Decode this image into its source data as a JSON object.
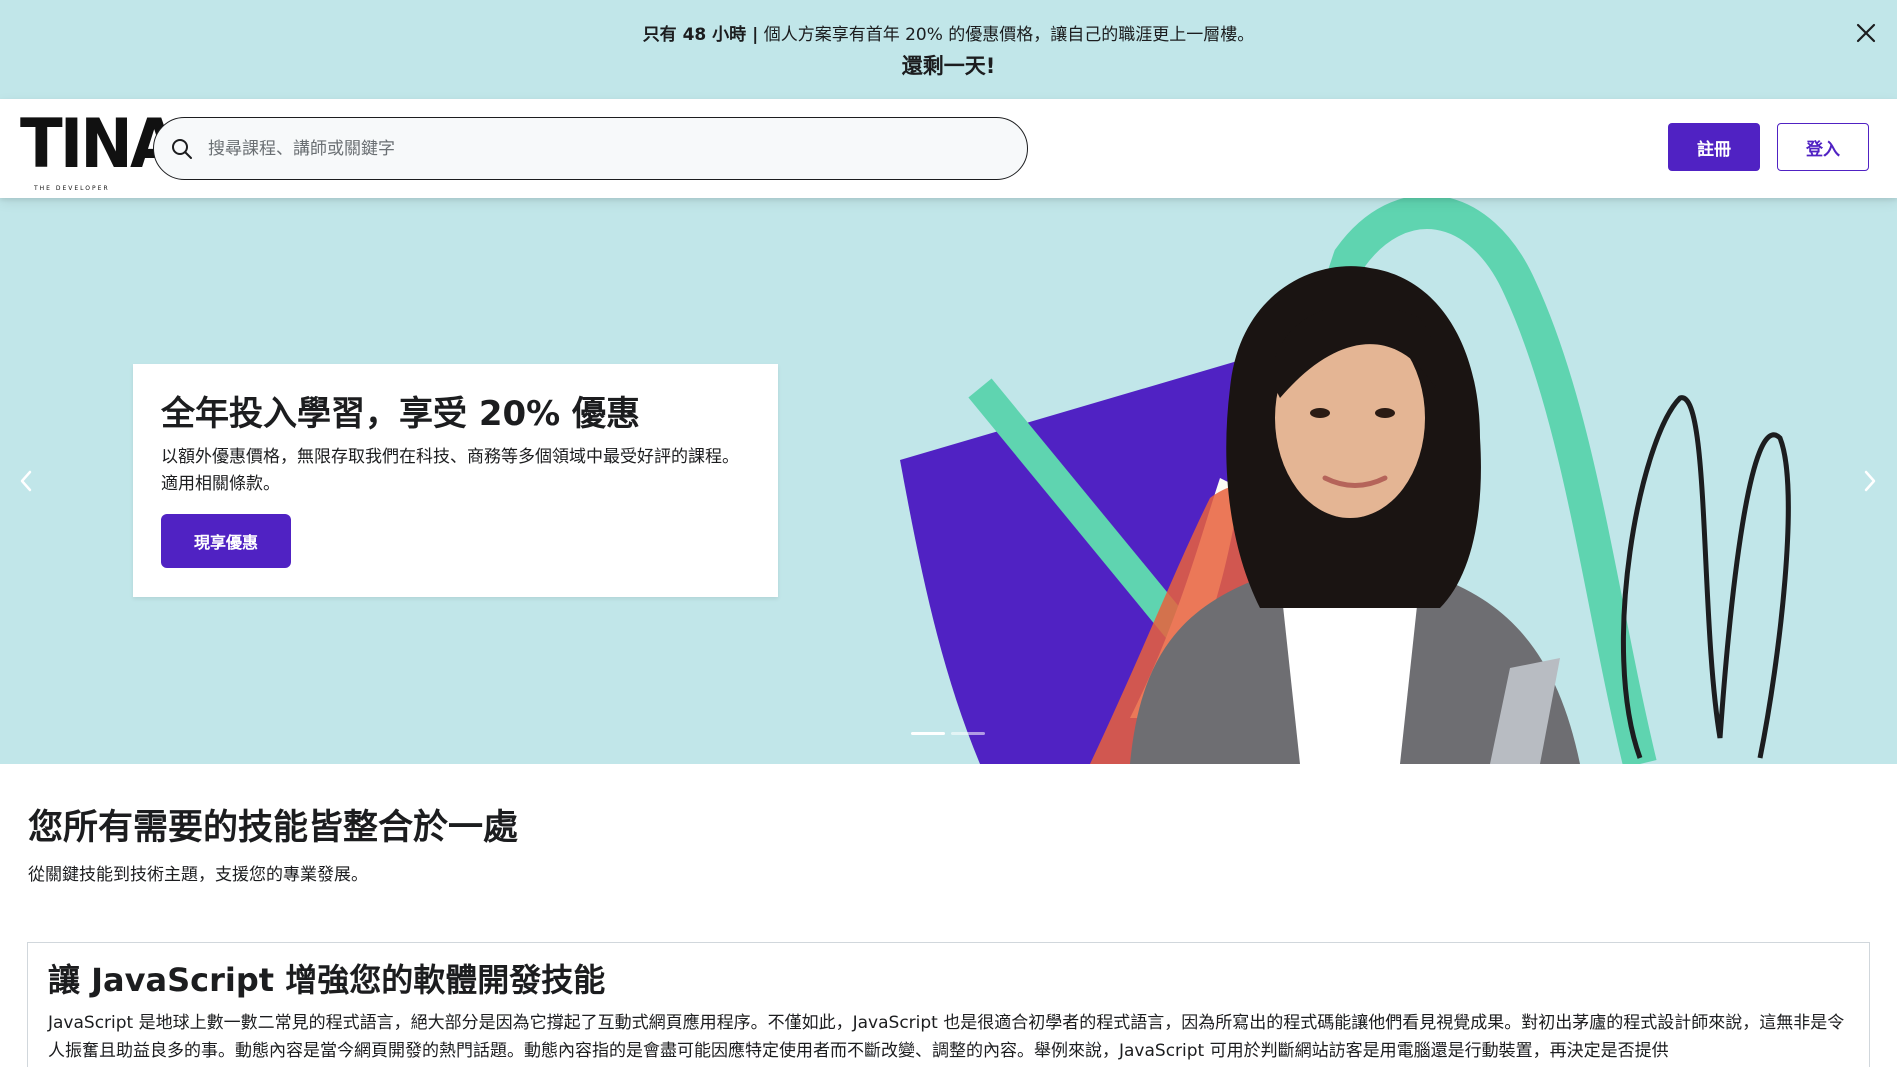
{
  "promo": {
    "line1_bold": "只有 48 小時 |",
    "line1_rest": " 個人方案享有首年 20% 的優惠價格，讓自己的職涯更上一層樓。",
    "line2": "還剩一天!",
    "close_icon": "close-icon"
  },
  "header": {
    "logo_text": "TINA",
    "logo_sub": "THE DEVELOPER",
    "search_placeholder": "搜尋課程、講師或關鍵字",
    "signup_label": "註冊",
    "login_label": "登入"
  },
  "hero": {
    "title": "全年投入學習，享受 20% 優惠",
    "description": "以額外優惠價格，無限存取我們在科技、商務等多個領域中最受好評的課程。適用相關條款。",
    "cta_label": "現享優惠",
    "active_slide": 1,
    "slide_count": 2
  },
  "skills": {
    "title": "您所有需要的技能皆整合於一處",
    "subtitle": "從關鍵技能到技術主題，支援您的專業發展。"
  },
  "js_card": {
    "title": "讓 JavaScript 增強您的軟體開發技能",
    "body": "JavaScript 是地球上數一數二常見的程式語言，絕大部分是因為它撐起了互動式網頁應用程序。不僅如此，JavaScript 也是很適合初學者的程式語言，因為所寫出的程式碼能讓他們看見視覺成果。對初出茅廬的程式設計師來說，這無非是令人振奮且助益良多的事。動態內容是當今網頁開發的熱門話題。動態內容指的是會盡可能因應特定使用者而不斷改變、調整的內容。舉例來說，JavaScript 可用於判斷網站訪客是用電腦還是行動裝置，再決定是否提供"
  },
  "colors": {
    "banner_bg": "#c1e6e9",
    "brand_purple": "#5022c3",
    "text": "#1c1d1f",
    "hero_green": "#5fd4b0",
    "hero_orange": "#e8603c"
  }
}
